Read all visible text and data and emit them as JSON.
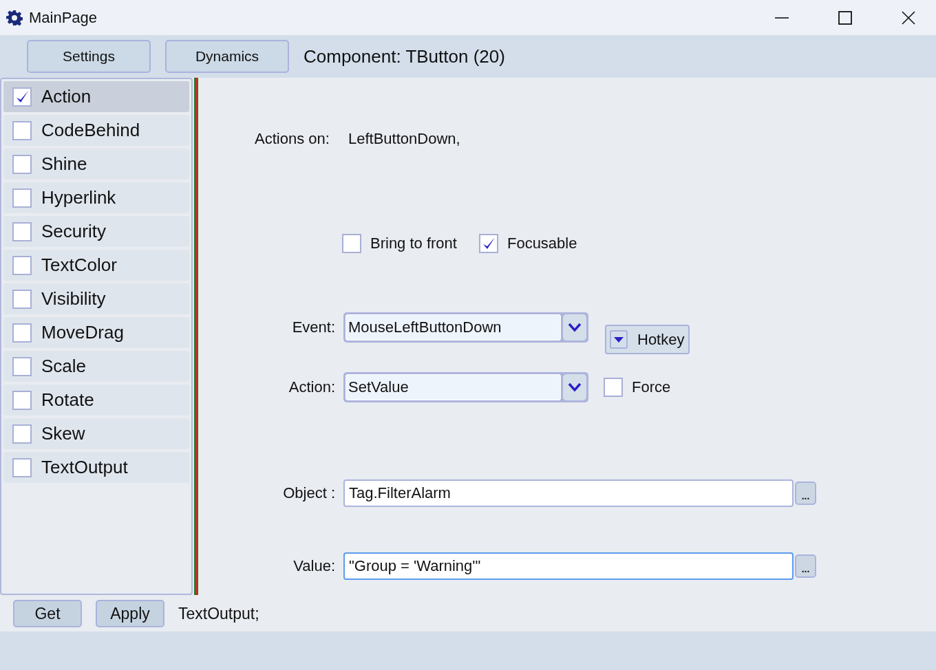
{
  "window": {
    "title": "MainPage"
  },
  "toolbar": {
    "buttons": [
      "Settings",
      "Dynamics"
    ],
    "component": "Component: TButton (20)"
  },
  "dynamics": [
    {
      "label": "Action",
      "checked": true,
      "selected": true
    },
    {
      "label": "CodeBehind",
      "checked": false,
      "selected": false
    },
    {
      "label": "Shine",
      "checked": false,
      "selected": false
    },
    {
      "label": "Hyperlink",
      "checked": false,
      "selected": false
    },
    {
      "label": "Security",
      "checked": false,
      "selected": false
    },
    {
      "label": "TextColor",
      "checked": false,
      "selected": false
    },
    {
      "label": "Visibility",
      "checked": false,
      "selected": false
    },
    {
      "label": "MoveDrag",
      "checked": false,
      "selected": false
    },
    {
      "label": "Scale",
      "checked": false,
      "selected": false
    },
    {
      "label": "Rotate",
      "checked": false,
      "selected": false
    },
    {
      "label": "Skew",
      "checked": false,
      "selected": false
    },
    {
      "label": "TextOutput",
      "checked": false,
      "selected": false
    }
  ],
  "actions_on": {
    "label": "Actions on:",
    "value": "LeftButtonDown,"
  },
  "options": [
    {
      "label": "Bring to front",
      "checked": false
    },
    {
      "label": "Focusable",
      "checked": true
    }
  ],
  "event": {
    "label": "Event:",
    "value": "MouseLeftButtonDown"
  },
  "hotkey": {
    "label": "Hotkey"
  },
  "action": {
    "label": "Action:",
    "value": "SetValue"
  },
  "force": {
    "label": "Force",
    "checked": false
  },
  "fields": [
    {
      "label": "Object :",
      "value": "Tag.FilterAlarm",
      "browse": "...",
      "focused": false
    },
    {
      "label": "Value:",
      "value": "\"Group = 'Warning'\"",
      "browse": "...",
      "focused": true
    }
  ],
  "footer": {
    "buttons": [
      "Get",
      "Apply"
    ],
    "status": "TextOutput;"
  }
}
